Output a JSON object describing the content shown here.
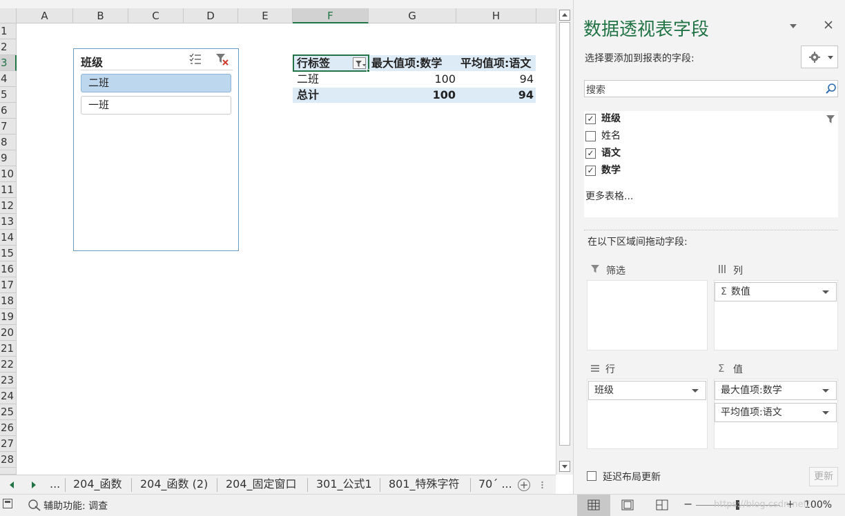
{
  "columns": [
    "A",
    "B",
    "C",
    "D",
    "E",
    "F",
    "G",
    "H"
  ],
  "rows": [
    "1",
    "2",
    "3",
    "4",
    "5",
    "6",
    "7",
    "8",
    "9",
    "10",
    "11",
    "12",
    "13",
    "14",
    "15",
    "16",
    "17",
    "18",
    "19",
    "20",
    "21",
    "22",
    "23",
    "24",
    "25",
    "26",
    "27",
    "28"
  ],
  "slicer": {
    "title": "班级",
    "items": [
      "二班",
      "一班"
    ]
  },
  "pivot": {
    "row_label_header": "行标签",
    "value_headers": [
      "最大值项:数学",
      "平均值项:语文"
    ],
    "rows": [
      {
        "label": "二班",
        "values": [
          "100",
          "94"
        ]
      }
    ],
    "total": {
      "label": "总计",
      "values": [
        "100",
        "94"
      ]
    }
  },
  "panel": {
    "title": "数据透视表字段",
    "subtitle": "选择要添加到报表的字段:",
    "search_placeholder": "搜索",
    "fields": [
      {
        "name": "班级",
        "checked": true
      },
      {
        "name": "姓名",
        "checked": false
      },
      {
        "name": "语文",
        "checked": true
      },
      {
        "name": "数学",
        "checked": true
      }
    ],
    "more_tables": "更多表格...",
    "drag_label": "在以下区域间拖动字段:",
    "areas": {
      "filter": {
        "label": "筛选"
      },
      "columns": {
        "label": "列",
        "items": [
          "数值"
        ]
      },
      "rows": {
        "label": "行",
        "items": [
          "班级"
        ]
      },
      "values": {
        "label": "值",
        "items": [
          "最大值项:数学",
          "平均值项:语文"
        ]
      }
    },
    "defer_label": "延迟布局更新",
    "update_button": "更新"
  },
  "sheet_tabs": [
    "204_函数",
    "204_函数 (2)",
    "204_固定窗口",
    "301_公式1",
    "801_特殊字符",
    "70´ ..."
  ],
  "tab_ellipsis": "...",
  "status": {
    "accessibility": "辅助功能: 调查",
    "zoom": "100%",
    "watermark": "https://blog.csdn.net/..."
  },
  "colors": {
    "accent": "#217346",
    "slicer_selected": "#bdd7ee",
    "pivot_band": "#ddebf7"
  }
}
